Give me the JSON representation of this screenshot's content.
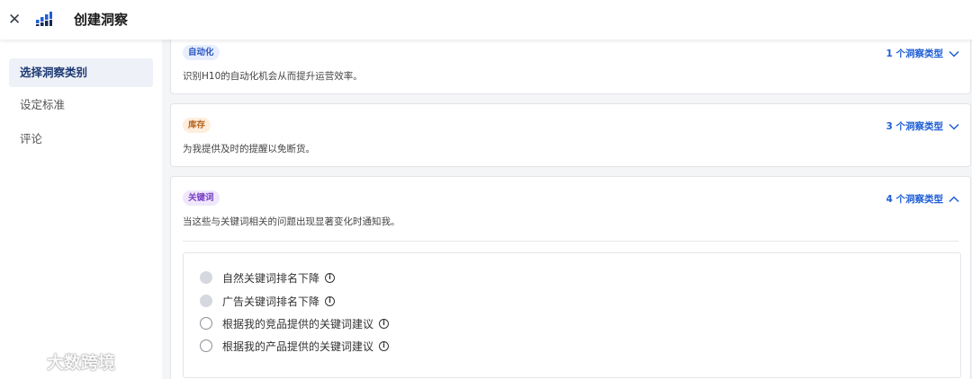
{
  "header": {
    "title": "创建洞察",
    "close_icon": "close-icon",
    "logo_icon": "bar-chart-logo-icon"
  },
  "sidebar": {
    "items": [
      {
        "label": "选择洞察类别",
        "active": true
      },
      {
        "label": "设定标准",
        "active": false
      },
      {
        "label": "评论",
        "active": false
      }
    ]
  },
  "cards": [
    {
      "badge": "自动化",
      "badge_color": "#2b56c4",
      "description": "识别H10的自动化机会从而提升运营效率。",
      "count": "1 个洞察类型",
      "expanded": false
    },
    {
      "badge": "库存",
      "badge_color": "#b8641f",
      "description": "为我提供及时的提醒以免断货。",
      "count": "3 个洞察类型",
      "expanded": false
    },
    {
      "badge": "关键词",
      "badge_color": "#7a3fc4",
      "description": "当这些与关键词相关的问题出现显著变化时通知我。",
      "count": "4 个洞察类型",
      "expanded": true,
      "options": [
        {
          "label": "自然关键词排名下降",
          "state": "disabled",
          "icon": "info-icon"
        },
        {
          "label": "广告关键词排名下降",
          "state": "disabled",
          "icon": "info-icon"
        },
        {
          "label": "根据我的竞品提供的关键词建议",
          "state": "unselected",
          "icon": "info-icon"
        },
        {
          "label": "根据我的产品提供的关键词建议",
          "state": "unselected",
          "icon": "info-icon"
        }
      ]
    }
  ],
  "watermark": {
    "text": "大数跨境"
  },
  "colors": {
    "accent": "#1f5ed6",
    "active_nav_bg": "#eef1f7",
    "page_bg": "#f4f5f7"
  }
}
